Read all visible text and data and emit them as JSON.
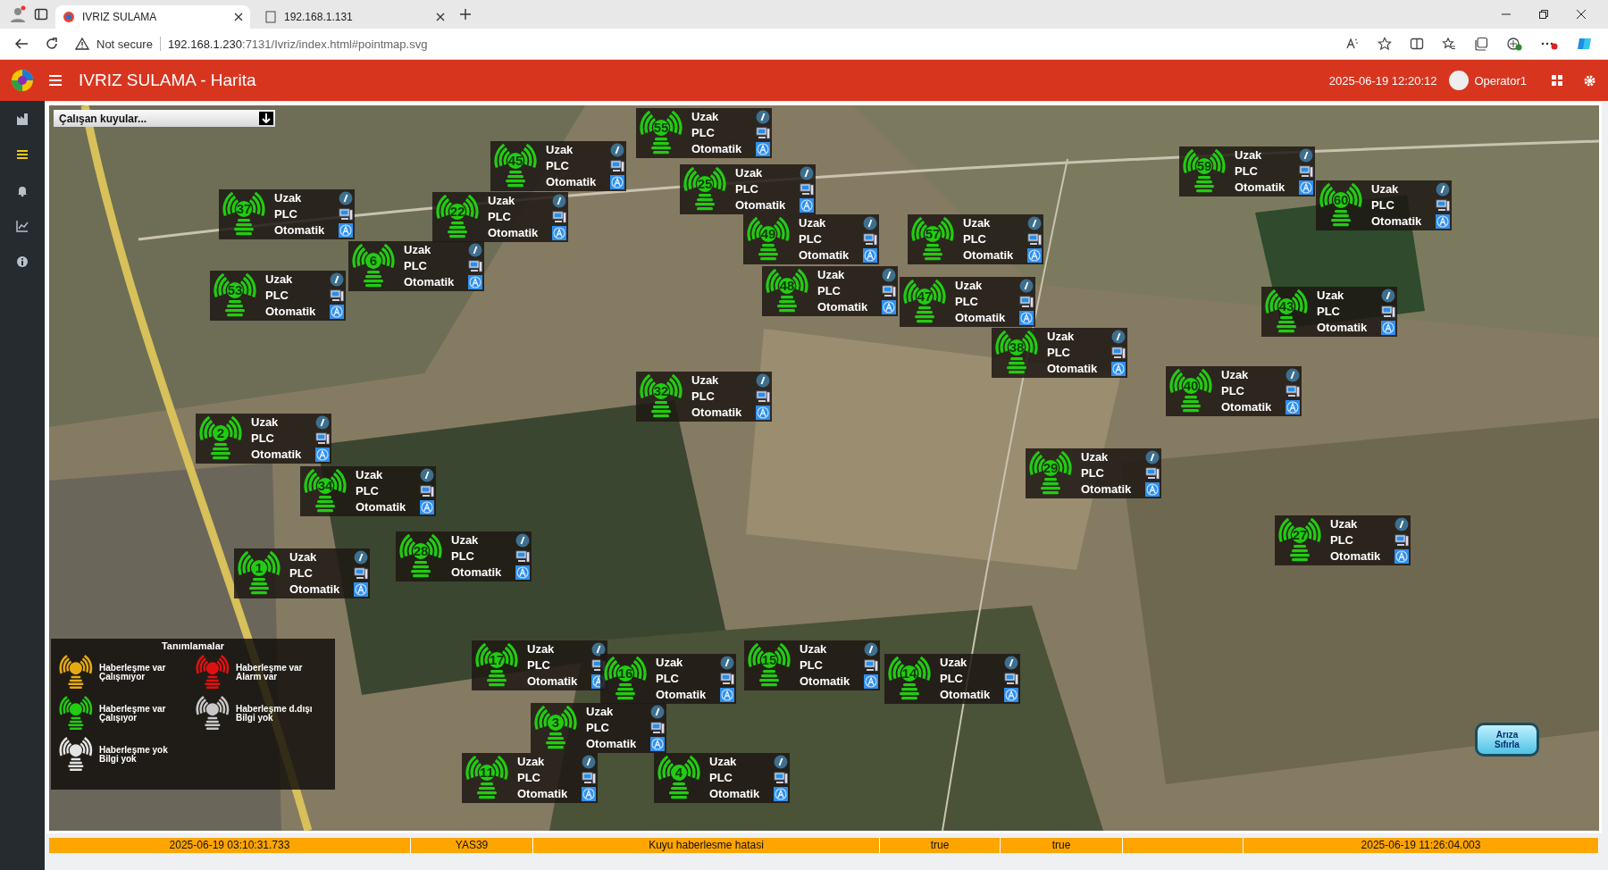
{
  "browser": {
    "tabs": [
      {
        "title": "IVRIZ SULAMA",
        "selected": true
      },
      {
        "title": "192.168.1.131",
        "selected": false
      }
    ],
    "security": "Not secure",
    "url_host": "192.168.1.230",
    "url_rest": ":7131/Ivriz/index.html#pointmap.svg"
  },
  "header": {
    "title": "IVRIZ SULAMA - Harita",
    "datetime": "2025-06-19 12:20:12",
    "user": "Operator1"
  },
  "sidebar": {
    "items": [
      {
        "kind": "factory",
        "selected": false
      },
      {
        "kind": "list",
        "selected": true
      },
      {
        "kind": "bell",
        "selected": false
      },
      {
        "kind": "chart",
        "selected": false
      },
      {
        "kind": "info",
        "selected": false
      }
    ]
  },
  "filter": {
    "value": "Çalışan kuyular..."
  },
  "wells": [
    {
      "number": "55",
      "color": "#22cc11",
      "lines": [
        "Uzak",
        "PLC",
        "Otomatik"
      ]
    },
    {
      "number": "45",
      "color": "#22cc11",
      "lines": [
        "Uzak",
        "PLC",
        "Otomatik"
      ]
    },
    {
      "number": "59",
      "color": "#22cc11",
      "lines": [
        "Uzak",
        "PLC",
        "Otomatik"
      ]
    },
    {
      "number": "25",
      "color": "#22cc11",
      "lines": [
        "Uzak",
        "PLC",
        "Otomatik"
      ]
    },
    {
      "number": "37",
      "color": "#22cc11",
      "lines": [
        "Uzak",
        "PLC",
        "Otomatik"
      ]
    },
    {
      "number": "22",
      "color": "#22cc11",
      "lines": [
        "Uzak",
        "PLC",
        "Otomatik"
      ]
    },
    {
      "number": "60",
      "color": "#22cc11",
      "lines": [
        "Uzak",
        "PLC",
        "Otomatik"
      ]
    },
    {
      "number": "49",
      "color": "#22cc11",
      "lines": [
        "Uzak",
        "PLC",
        "Otomatik"
      ]
    },
    {
      "number": "57",
      "color": "#22cc11",
      "lines": [
        "Uzak",
        "PLC",
        "Otomatik"
      ]
    },
    {
      "number": "6",
      "color": "#22cc11",
      "lines": [
        "Uzak",
        "PLC",
        "Otomatik"
      ]
    },
    {
      "number": "53",
      "color": "#22cc11",
      "lines": [
        "Uzak",
        "PLC",
        "Otomatik"
      ]
    },
    {
      "number": "48",
      "color": "#22cc11",
      "lines": [
        "Uzak",
        "PLC",
        "Otomatik"
      ]
    },
    {
      "number": "47",
      "color": "#22cc11",
      "lines": [
        "Uzak",
        "PLC",
        "Otomatik"
      ]
    },
    {
      "number": "43",
      "color": "#22cc11",
      "lines": [
        "Uzak",
        "PLC",
        "Otomatik"
      ]
    },
    {
      "number": "38",
      "color": "#22cc11",
      "lines": [
        "Uzak",
        "PLC",
        "Otomatik"
      ]
    },
    {
      "number": "32",
      "color": "#22cc11",
      "lines": [
        "Uzak",
        "PLC",
        "Otomatik"
      ]
    },
    {
      "number": "40",
      "color": "#22cc11",
      "lines": [
        "Uzak",
        "PLC",
        "Otomatik"
      ]
    },
    {
      "number": "2",
      "color": "#22cc11",
      "lines": [
        "Uzak",
        "PLC",
        "Otomatik"
      ]
    },
    {
      "number": "34",
      "color": "#22cc11",
      "lines": [
        "Uzak",
        "PLC",
        "Otomatik"
      ]
    },
    {
      "number": "29",
      "color": "#22cc11",
      "lines": [
        "Uzak",
        "PLC",
        "Otomatik"
      ]
    },
    {
      "number": "1",
      "color": "#22cc11",
      "lines": [
        "Uzak",
        "PLC",
        "Otomatik"
      ]
    },
    {
      "number": "28",
      "color": "#22cc11",
      "lines": [
        "Uzak",
        "PLC",
        "Otomatik"
      ]
    },
    {
      "number": "27",
      "color": "#22cc11",
      "lines": [
        "Uzak",
        "PLC",
        "Otomatik"
      ]
    },
    {
      "number": "17",
      "color": "#22cc11",
      "lines": [
        "Uzak",
        "PLC",
        "Otomatik"
      ]
    },
    {
      "number": "16",
      "color": "#22cc11",
      "lines": [
        "Uzak",
        "PLC",
        "Otomatik"
      ]
    },
    {
      "number": "15",
      "color": "#22cc11",
      "lines": [
        "Uzak",
        "PLC",
        "Otomatik"
      ]
    },
    {
      "number": "14",
      "color": "#22cc11",
      "lines": [
        "Uzak",
        "PLC",
        "Otomatik"
      ]
    },
    {
      "number": "3",
      "color": "#22cc11",
      "lines": [
        "Uzak",
        "PLC",
        "Otomatik"
      ]
    },
    {
      "number": "11",
      "color": "#22cc11",
      "lines": [
        "Uzak",
        "PLC",
        "Otomatik"
      ]
    },
    {
      "number": "4",
      "color": "#22cc11",
      "lines": [
        "Uzak",
        "PLC",
        "Otomatik"
      ]
    }
  ],
  "legend": {
    "title": "Tanımlamalar",
    "items": [
      {
        "color": "#e6aa10",
        "label": "Haberleşme var\nÇalışmıyor"
      },
      {
        "color": "#e01010",
        "label": "Haberleşme var\nAlarm var"
      },
      {
        "color": "#22cc11",
        "label": "Haberleşme var\nÇalışıyor"
      },
      {
        "color": "#c8c8c8",
        "label": "Haberleşme d.dışı\nBilgi yok"
      },
      {
        "color": "#e4e4e4",
        "label": "Haberleşme yok\nBilgi yok"
      }
    ]
  },
  "reset_button": {
    "label": "Arıza\nSıfırla"
  },
  "status_bar": {
    "cells": [
      "2025-06-19 03:10:31.733",
      "YAS39",
      "Kuyu haberlesme hatasi",
      "true",
      "true",
      null,
      "2025-06-19 11:26:04.003"
    ]
  }
}
